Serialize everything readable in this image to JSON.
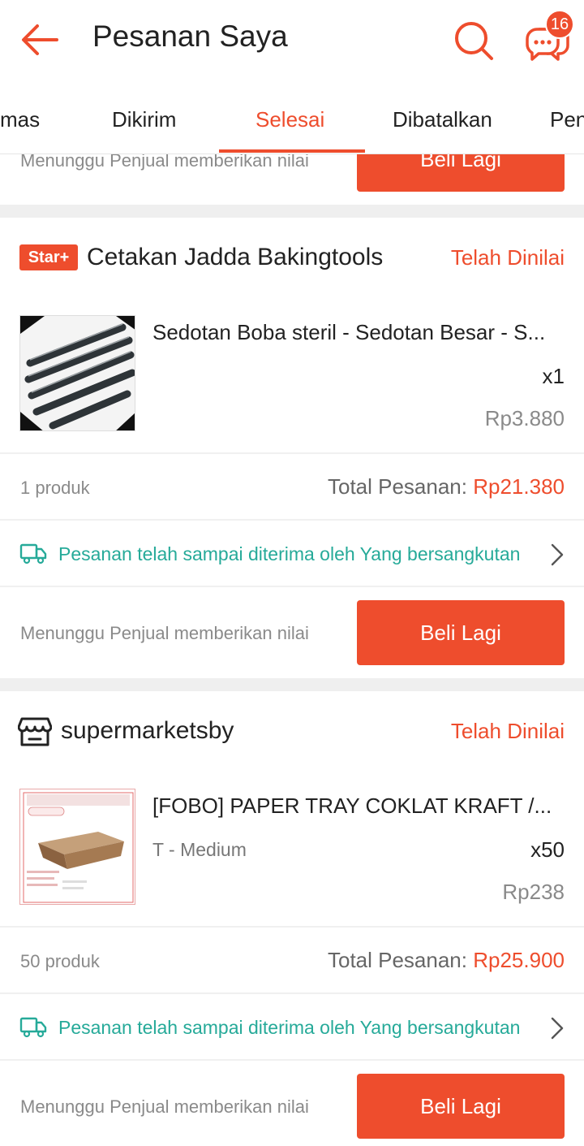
{
  "header": {
    "title": "Pesanan Saya",
    "chat_badge": "16"
  },
  "tabs": [
    "mas",
    "Dikirim",
    "Selesai",
    "Dibatalkan",
    "Pen"
  ],
  "top_card": {
    "note": "Menunggu Penjual memberikan nilai",
    "button": "Beli Lagi"
  },
  "orders": [
    {
      "badge": "Star+",
      "shop": "Cetakan Jadda Bakingtools",
      "status": "Telah Dinilai",
      "product_name": "Sedotan Boba steril - Sedotan Besar - S...",
      "variant": "",
      "qty": "x1",
      "price": "Rp3.880",
      "count": "1 produk",
      "total_label": "Total Pesanan:",
      "total_value": "Rp21.380",
      "shipping": "Pesanan telah sampai diterima oleh Yang bersangkutan",
      "note": "Menunggu Penjual memberikan nilai",
      "button": "Beli Lagi"
    },
    {
      "badge": "",
      "shop": "supermarketsby",
      "status": "Telah Dinilai",
      "product_name": "[FOBO] PAPER TRAY COKLAT KRAFT /...",
      "variant": "T - Medium",
      "qty": "x50",
      "price": "Rp238",
      "count": "50 produk",
      "total_label": "Total Pesanan:",
      "total_value": "Rp25.900",
      "shipping": "Pesanan telah sampai diterima oleh Yang bersangkutan",
      "note": "Menunggu Penjual memberikan nilai",
      "button": "Beli Lagi"
    }
  ],
  "colors": {
    "accent": "#ee4d2d",
    "shipping": "#26aa99"
  },
  "icons": [
    "back-arrow-icon",
    "search-icon",
    "chat-icon",
    "shop-icon",
    "truck-icon",
    "chevron-right-icon"
  ]
}
